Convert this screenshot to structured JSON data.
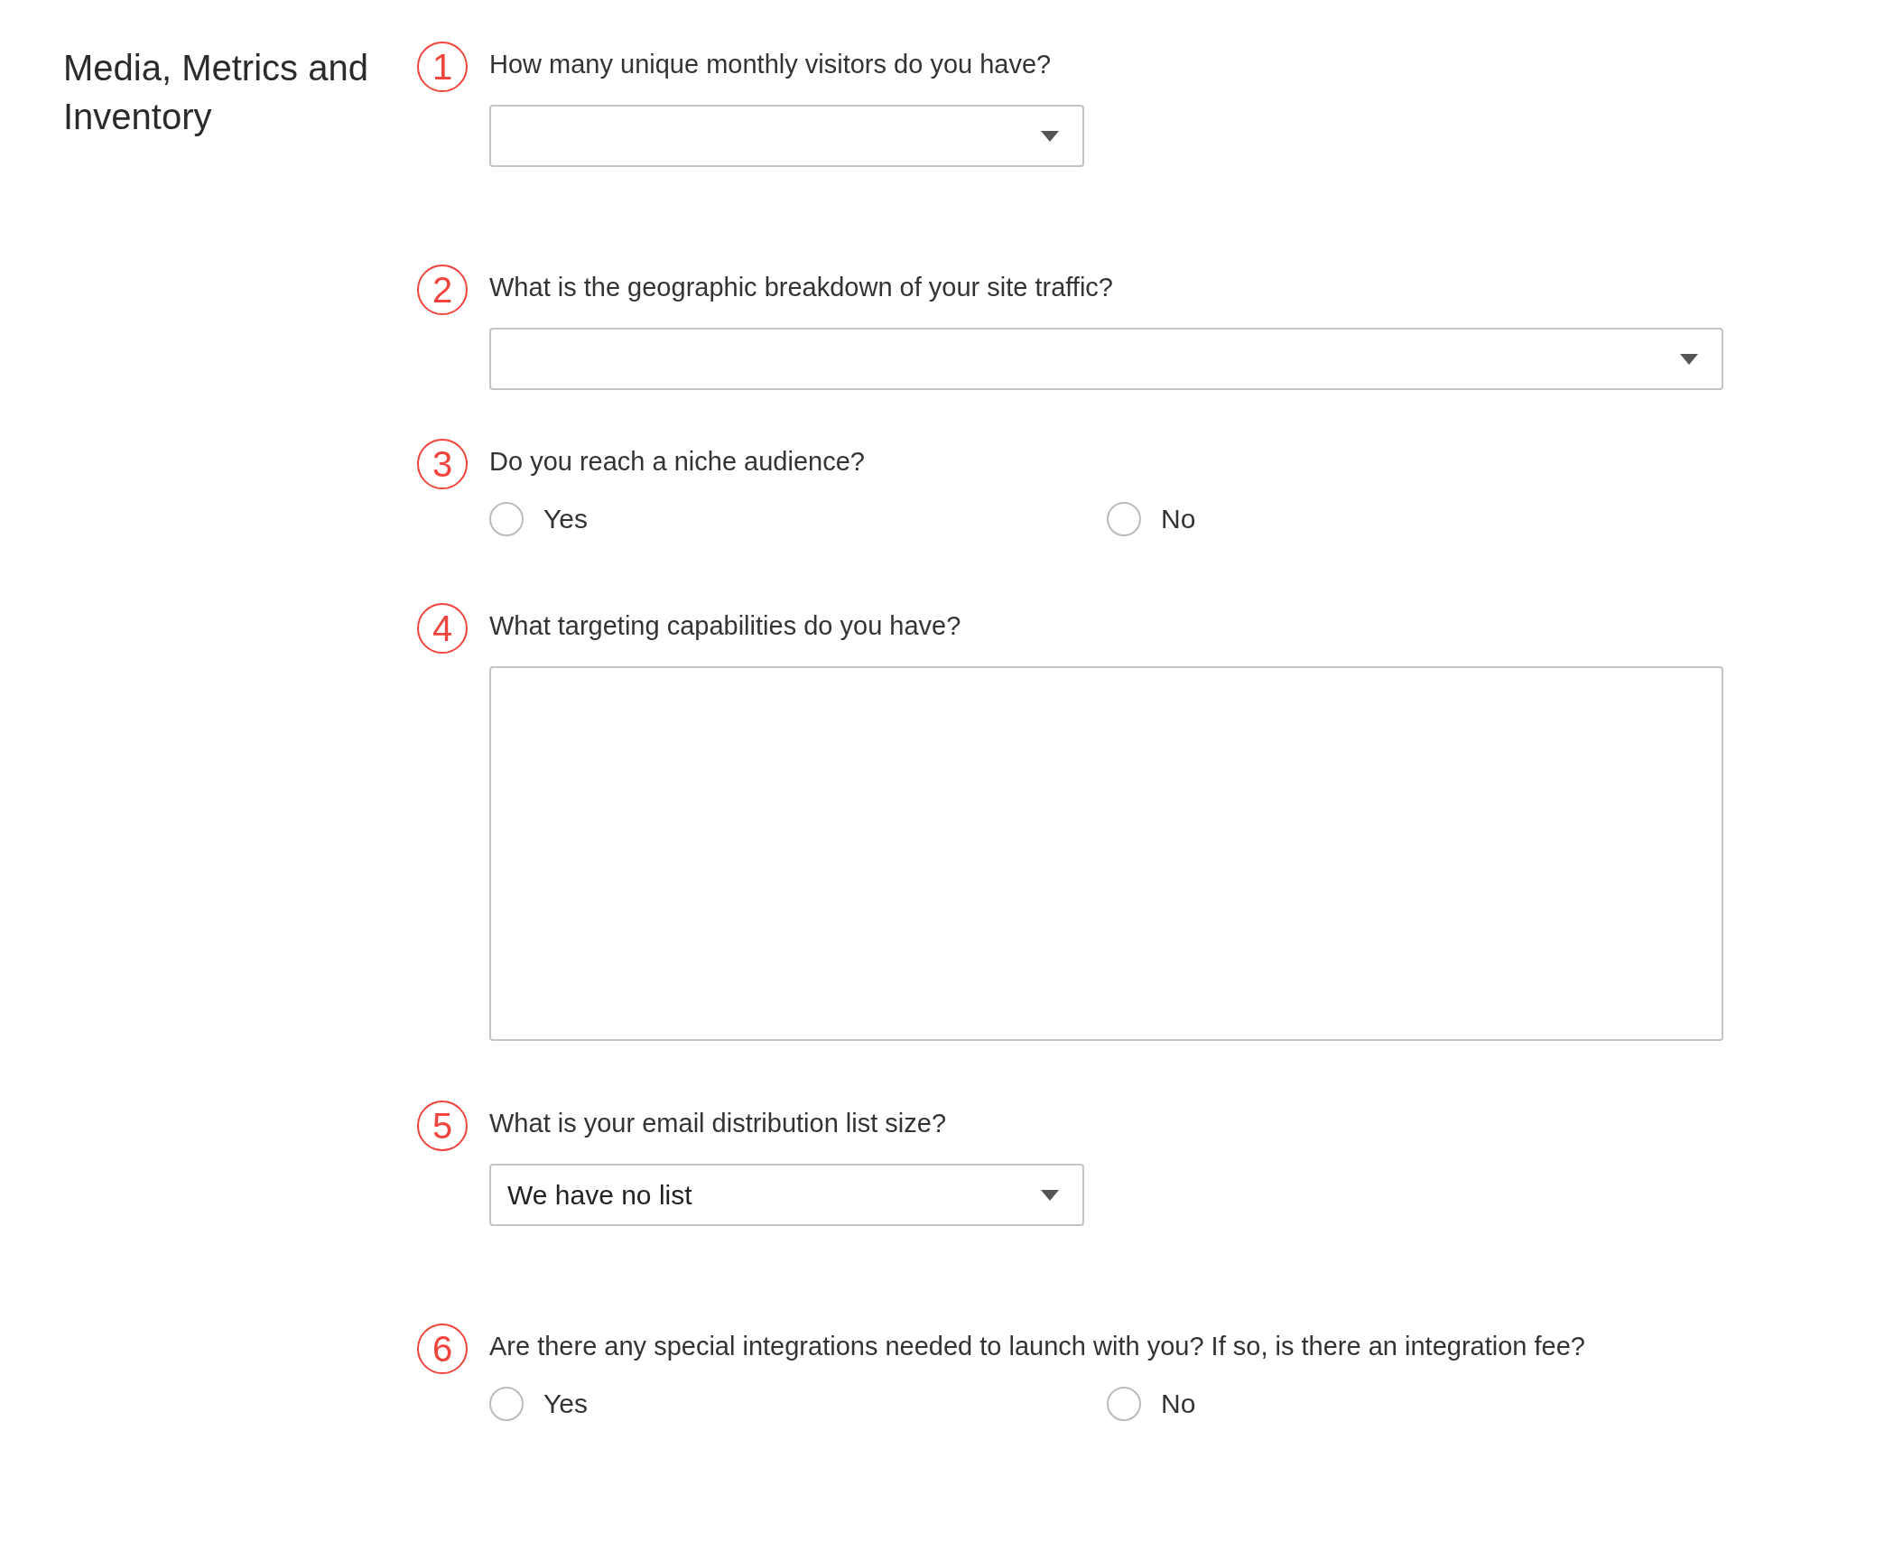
{
  "section_title": "Media, Metrics and Inventory",
  "questions": [
    {
      "number": "1",
      "kind": "select",
      "label": "How many unique monthly visitors do you have?"
    },
    {
      "number": "2",
      "kind": "wide_select",
      "label": "What is the geographic breakdown of your site traffic?"
    },
    {
      "number": "3",
      "kind": "radio",
      "label": "Do you reach a niche audience?",
      "options": [
        {
          "label": "Yes",
          "selected": false
        },
        {
          "label": "No",
          "selected": false
        }
      ]
    },
    {
      "number": "4",
      "kind": "textarea",
      "label": "What targeting capabilities do you have?"
    },
    {
      "number": "5",
      "kind": "select",
      "label": "What is your email distribution list size?",
      "value": "We have no list"
    },
    {
      "number": "6",
      "kind": "radio",
      "label": "Are there any special integrations needed to launch with you? If so, is there an integration fee?",
      "options": [
        {
          "label": "Yes",
          "selected": false
        },
        {
          "label": "No",
          "selected": false
        }
      ]
    }
  ]
}
